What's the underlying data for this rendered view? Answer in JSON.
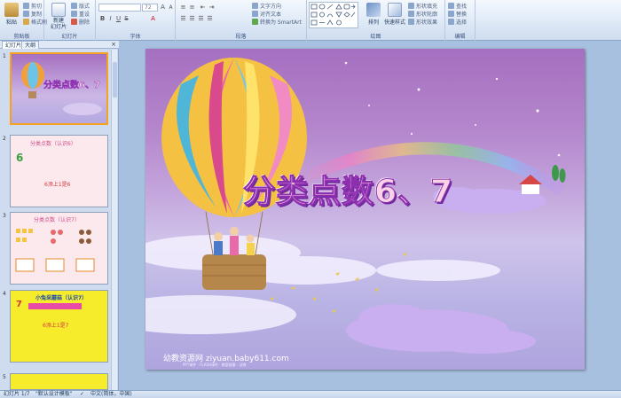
{
  "ribbon": {
    "clipboard": {
      "label": "剪贴板",
      "paste": "粘贴",
      "cut": "剪切",
      "copy": "复制",
      "format_painter": "格式刷"
    },
    "slides": {
      "label": "幻灯片",
      "new_slide": "新建\n幻灯片",
      "layout": "版式",
      "reset": "重设",
      "delete": "删除"
    },
    "font": {
      "label": "字体",
      "font_size": "72"
    },
    "paragraph": {
      "label": "段落",
      "text_direction": "文字方向",
      "align_text": "对齐文本",
      "smartart": "转换为 SmartArt"
    },
    "drawing": {
      "label": "绘图",
      "arrange": "排列",
      "quick_styles": "快速样式",
      "shape_fill": "形状填充",
      "shape_outline": "形状轮廓",
      "shape_effects": "形状效果"
    },
    "editing": {
      "label": "编辑",
      "find": "查找",
      "replace": "替换",
      "select": "选择"
    }
  },
  "panel": {
    "tab_slides": "幻灯片",
    "tab_outline": "大纲",
    "close": "×",
    "thumbs": [
      {
        "num": "1"
      },
      {
        "num": "2",
        "title": "分类点数（认识6）",
        "digit": "6",
        "caption": "6添上1是6"
      },
      {
        "num": "3",
        "title": "分类点数（认识7）"
      },
      {
        "num": "4",
        "title": "小兔采蘑菇（认识7）",
        "digit": "7",
        "caption": "6添上1是7"
      },
      {
        "num": "5"
      }
    ]
  },
  "slide": {
    "title": "分类点数6、7",
    "footer": "幼教资源网 ziyuan.baby611.com",
    "footer_small": "PPT课件 · FLASH课件 · 教案故事 · 试卷"
  },
  "statusbar": {
    "slide_count": "幻灯片 1/7",
    "theme": "\"默认设计模板\"",
    "language": "中文(简体，中国)"
  },
  "colors": {
    "ribbon_bg": "#dde8f6",
    "selected_thumb_border": "#f6a21f",
    "slide_sky": "#b486cc"
  }
}
